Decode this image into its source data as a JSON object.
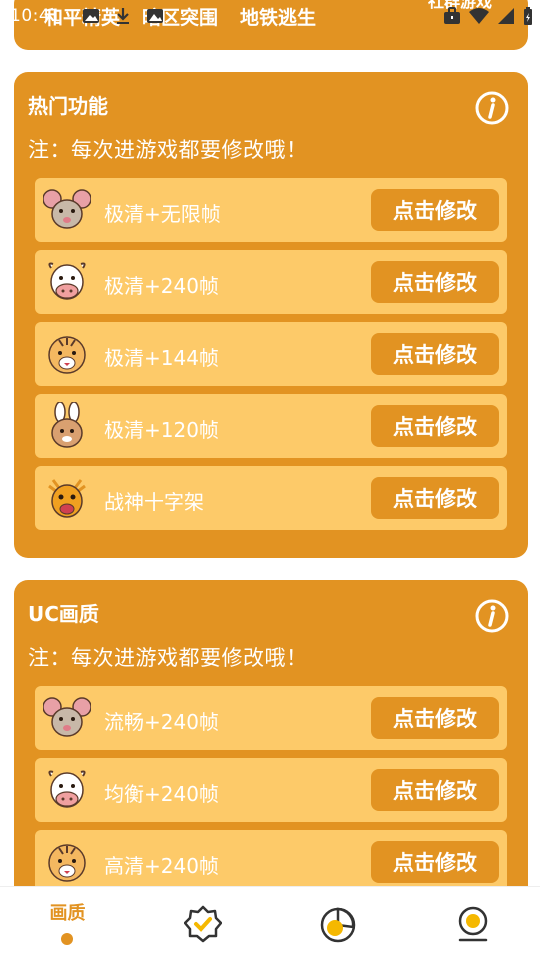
{
  "status_bar": {
    "time": "10:41",
    "clipped_text": "社群游戏",
    "icons": [
      "download-icon",
      "image-icon",
      "briefcase-icon",
      "wifi-icon",
      "signal-icon",
      "battery-icon"
    ]
  },
  "top_tabs": [
    "和平精英",
    "暗区突围",
    "地铁逃生"
  ],
  "sections": [
    {
      "title": "热门功能",
      "note": "注：每次进游戏都要修改哦！",
      "rows": [
        {
          "avatar": "mouse-avatar",
          "label": "极清+无限帧",
          "button": "点击修改"
        },
        {
          "avatar": "cow-avatar",
          "label": "极清+240帧",
          "button": "点击修改"
        },
        {
          "avatar": "tiger-avatar",
          "label": "极清+144帧",
          "button": "点击修改"
        },
        {
          "avatar": "rabbit-avatar",
          "label": "极清+120帧",
          "button": "点击修改"
        },
        {
          "avatar": "dragon-avatar",
          "label": "战神十字架",
          "button": "点击修改"
        }
      ]
    },
    {
      "title": "UC画质",
      "note": "注：每次进游戏都要修改哦！",
      "rows": [
        {
          "avatar": "mouse-avatar",
          "label": "流畅+240帧",
          "button": "点击修改"
        },
        {
          "avatar": "cow-avatar",
          "label": "均衡+240帧",
          "button": "点击修改"
        },
        {
          "avatar": "tiger-avatar",
          "label": "高清+240帧",
          "button": "点击修改"
        }
      ]
    }
  ],
  "bottom_nav": {
    "active_label": "画质",
    "items": [
      "home-quality-tab",
      "badge-check-icon",
      "pie-chart-icon",
      "profile-icon"
    ]
  },
  "colors": {
    "accent": "#e29322",
    "row_bg": "#fdca69",
    "text_light": "#ffffff"
  }
}
